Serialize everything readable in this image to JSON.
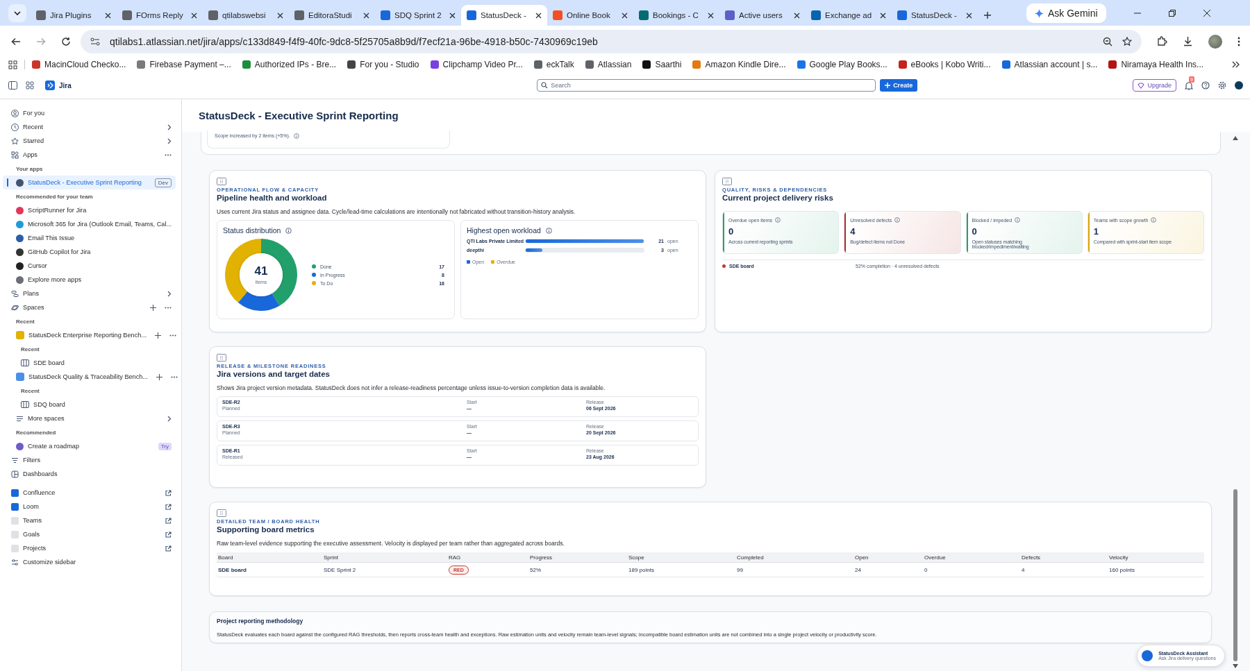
{
  "browser": {
    "tabs": [
      {
        "title": "Jira Plugins",
        "selected": false,
        "color": "#5f6368"
      },
      {
        "title": "FOrms Reply",
        "selected": false,
        "color": "#5f6368"
      },
      {
        "title": "qtilabswebsi",
        "selected": false,
        "color": "#5f6368"
      },
      {
        "title": "EditoraStudi",
        "selected": false,
        "color": "#5f6368"
      },
      {
        "title": "SDQ Sprint 2",
        "selected": false,
        "color": "#1868db"
      },
      {
        "title": "StatusDeck -",
        "selected": true,
        "color": "#1868db"
      },
      {
        "title": "Online Book",
        "selected": false,
        "color": "#f25022"
      },
      {
        "title": "Bookings - C",
        "selected": false,
        "color": "#036c70"
      },
      {
        "title": "Active users",
        "selected": false,
        "color": "#5b5fc7"
      },
      {
        "title": "Exchange ad",
        "selected": false,
        "color": "#0a64ad"
      },
      {
        "title": "StatusDeck -",
        "selected": false,
        "color": "#1868db"
      }
    ],
    "ask_button": "Ask Gemini",
    "address": "qtilabs1.atlassian.net/jira/apps/c133d849-f4f9-40fc-9dc8-5f25705a8b9d/f7ecf21a-96be-4918-b50c-7430969c19eb",
    "bookmarks": [
      {
        "label": "MacinCloud Checko...",
        "color": "#c9372c"
      },
      {
        "label": "Firebase Payment –...",
        "color": "#7a7a7a"
      },
      {
        "label": "Authorized IPs - Bre...",
        "color": "#1e8e3e"
      },
      {
        "label": "For you - Studio",
        "color": "#444444"
      },
      {
        "label": "Clipchamp Video Pr...",
        "color": "#7b3fe4"
      },
      {
        "label": "eckTalk",
        "color": "#5f6368"
      },
      {
        "label": "Atlassian",
        "color": "#5f6368"
      },
      {
        "label": "Saarthi",
        "color": "#111111"
      },
      {
        "label": "Amazon Kindle Dire...",
        "color": "#e47911"
      },
      {
        "label": "Google Play Books...",
        "color": "#1a73e8"
      },
      {
        "label": "eBooks | Kobo Writi...",
        "color": "#c5221f"
      },
      {
        "label": "Atlassian account | s...",
        "color": "#1868db"
      },
      {
        "label": "Niramaya Health Ins...",
        "color": "#b31412"
      }
    ]
  },
  "jira": {
    "product": "Jira",
    "search": {
      "placeholder": "Search"
    },
    "create_button": "Create",
    "upgrade_button": "Upgrade",
    "notification_count": "9"
  },
  "sidebar": {
    "items": [
      {
        "kind": "nav",
        "label": "For you",
        "selected": false
      },
      {
        "kind": "nav",
        "label": "Recent",
        "selected": false,
        "submenu": true
      },
      {
        "kind": "nav",
        "label": "Starred",
        "selected": false,
        "submenu": true
      },
      {
        "kind": "nav",
        "label": "Apps",
        "selected": false,
        "more": true,
        "children": [
          {
            "kind": "heading",
            "label": "Your apps"
          },
          {
            "kind": "app",
            "label": "StatusDeck - Executive Sprint Reporting",
            "selected": true,
            "badge": "Dev",
            "color": "#44546f"
          },
          {
            "kind": "heading",
            "label": "Recommended for your team"
          },
          {
            "kind": "app",
            "label": "ScriptRunner for Jira",
            "selected": false,
            "color": "#e2365c"
          },
          {
            "kind": "app",
            "label": "Microsoft 365 for Jira (Outlook Email, Teams, Cal...",
            "selected": false,
            "color": "#1f9bd8"
          },
          {
            "kind": "app",
            "label": "Email This Issue",
            "selected": false,
            "color": "#2a5ea8"
          },
          {
            "kind": "app",
            "label": "GitHub Copilot for Jira",
            "selected": false,
            "color": "#333333"
          },
          {
            "kind": "app",
            "label": "Cursor",
            "selected": false,
            "color": "#222222"
          },
          {
            "kind": "app",
            "label": "Explore more apps",
            "selected": false,
            "color": "#6b6e76"
          }
        ]
      },
      {
        "kind": "nav",
        "label": "Plans",
        "selected": false,
        "submenu": true
      },
      {
        "kind": "nav",
        "label": "Spaces",
        "selected": false,
        "add": true,
        "more": true,
        "children": [
          {
            "kind": "heading",
            "label": "Recent"
          },
          {
            "kind": "space",
            "label": "StatusDeck Enterprise Reporting Bench...",
            "selected": false,
            "color": "#e2b203",
            "add": true,
            "more": true,
            "children": [
              {
                "kind": "heading",
                "label": "Recent"
              },
              {
                "kind": "board",
                "label": "SDE board",
                "selected": false
              }
            ]
          },
          {
            "kind": "space",
            "label": "StatusDeck Quality & Traceability Bench...",
            "selected": false,
            "color": "#4c8fe8",
            "add": true,
            "more": true,
            "children": [
              {
                "kind": "heading",
                "label": "Recent"
              },
              {
                "kind": "board",
                "label": "SDQ board",
                "selected": false
              }
            ]
          },
          {
            "kind": "nav",
            "label": "More spaces",
            "selected": false,
            "submenu": true
          },
          {
            "kind": "heading",
            "label": "Recommended"
          },
          {
            "kind": "app",
            "label": "Create a roadmap",
            "selected": false,
            "badge": "Try",
            "color": "#6e5dc6"
          }
        ]
      },
      {
        "kind": "nav",
        "label": "Filters",
        "selected": false
      },
      {
        "kind": "nav",
        "label": "Dashboards",
        "selected": false
      },
      {
        "kind": "product",
        "label": "Confluence",
        "selected": false,
        "color": "#1868db",
        "external": true
      },
      {
        "kind": "product",
        "label": "Loom",
        "selected": false,
        "color": "#1868db",
        "external": true
      },
      {
        "kind": "product",
        "label": "Teams",
        "selected": false,
        "color": "#dfe1e6",
        "external": true
      },
      {
        "kind": "product",
        "label": "Goals",
        "selected": false,
        "color": "#dfe1e6",
        "external": true
      },
      {
        "kind": "product",
        "label": "Projects",
        "selected": false,
        "color": "#dfe1e6",
        "external": true
      },
      {
        "kind": "nav",
        "label": "Customize sidebar",
        "selected": false
      }
    ]
  },
  "page": {
    "title": "StatusDeck - Executive Sprint Reporting",
    "scope_note": "Scope increased by 2 items (+5%).",
    "pipeline": {
      "eyebrow": "OPERATIONAL FLOW & CAPACITY",
      "title": "Pipeline health and workload",
      "description": "Uses current Jira status and assignee data. Cycle/lead-time calculations are intentionally not fabricated without transition-history analysis.",
      "status": {
        "title": "Status distribution",
        "total": "41",
        "total_label": "items",
        "chart_data": {
          "type": "donut",
          "values": [
            41.5,
            19.5,
            39
          ]
        },
        "legend": [
          {
            "label": "Done",
            "value": "17",
            "color": "#22a06b"
          },
          {
            "label": "In Progress",
            "value": "8",
            "color": "#1868db"
          },
          {
            "label": "To Do",
            "value": "16",
            "color": "#e2b203"
          }
        ]
      },
      "workload": {
        "title": "Highest open workload",
        "rows": [
          {
            "name": "QTI Labs Private Limited",
            "level": 1.0,
            "count": "21",
            "unit": "open"
          },
          {
            "name": "deepthi",
            "level": 0.14,
            "count": "3",
            "unit": "open"
          }
        ],
        "legend": [
          {
            "label": "Open",
            "color": "#1868db"
          },
          {
            "label": "Overdue",
            "color": "#e2b203"
          }
        ]
      }
    },
    "quality": {
      "eyebrow": "QUALITY, RISKS & DEPENDENCIES",
      "title": "Current project delivery risks",
      "metrics": [
        {
          "label": "Overdue open items",
          "value": "0",
          "note": "Across current reporting sprints",
          "color": "#22a06b"
        },
        {
          "label": "Unresolved defects",
          "value": "4",
          "note": "Bug/defect items not Done",
          "color": "#ae2e24"
        },
        {
          "label": "Blocked / impeded",
          "value": "0",
          "note": "Open statuses matching blocked/impediment/waiting",
          "color": "#22a06b"
        },
        {
          "label": "Teams with scope growth",
          "value": "1",
          "note": "Compared with sprint-start item scope",
          "color": "#d9a800"
        }
      ],
      "boards": [
        {
          "name": "SDE board",
          "summary": "52% completion · 4 unresolved defects",
          "color": "#c9372c"
        }
      ]
    },
    "release": {
      "eyebrow": "RELEASE & MILESTONE READINESS",
      "title": "Jira versions and target dates",
      "description": "Shows Jira project version metadata. StatusDeck does not infer a release-readiness percentage unless issue-to-version completion data is available.",
      "versions": [
        {
          "name": "SDE-R2",
          "status": "Planned",
          "start_label": "Start",
          "start": "—",
          "release_label": "Release",
          "release": "06 Sept 2026"
        },
        {
          "name": "SDE-R3",
          "status": "Planned",
          "start_label": "Start",
          "start": "—",
          "release_label": "Release",
          "release": "20 Sept 2026"
        },
        {
          "name": "SDE-R1",
          "status": "Released",
          "start_label": "Start",
          "start": "—",
          "release_label": "Release",
          "release": "23 Aug 2026"
        }
      ]
    },
    "board_metrics": {
      "eyebrow": "DETAILED TEAM / BOARD HEALTH",
      "title": "Supporting board metrics",
      "description": "Raw team-level evidence supporting the executive assessment. Velocity is displayed per team rather than aggregated across boards.",
      "columns": [
        "Board",
        "Sprint",
        "RAG",
        "Progress",
        "Scope",
        "Completed",
        "Open",
        "Overdue",
        "Defects",
        "Velocity"
      ],
      "rows": [
        {
          "cells": [
            "SDE board",
            "SDE Sprint 2",
            "RED",
            "52%",
            "189 points",
            "99",
            "24",
            "0",
            "4",
            "160 points"
          ],
          "color": "#c9372c"
        }
      ]
    },
    "methodology": {
      "title": "Project reporting methodology",
      "text": "StatusDeck evaluates each board against the configured RAG thresholds, then reports cross-team health and exceptions. Raw estimation units and velocity remain team-level signals; incompatible board estimation units are not combined into a single project velocity or productivity score."
    },
    "assistant": {
      "title": "StatusDeck Assistant",
      "subtitle": "Ask Jira delivery questions"
    }
  }
}
